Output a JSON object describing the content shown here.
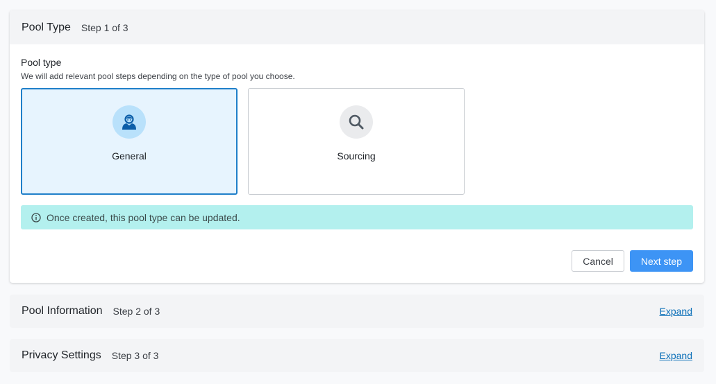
{
  "step1": {
    "title": "Pool Type",
    "count": "Step 1 of 3",
    "field_label": "Pool type",
    "field_help": "We will add relevant pool steps depending on the type of pool you choose.",
    "options": [
      {
        "label": "General",
        "icon": "person-icon",
        "selected": true
      },
      {
        "label": "Sourcing",
        "icon": "search-icon",
        "selected": false
      }
    ],
    "notice": "Once created, this pool type can be updated.",
    "cancel_label": "Cancel",
    "next_label": "Next step"
  },
  "step2": {
    "title": "Pool Information",
    "count": "Step 2 of 3",
    "expand_label": "Expand"
  },
  "step3": {
    "title": "Privacy Settings",
    "count": "Step 3 of 3",
    "expand_label": "Expand"
  },
  "colors": {
    "primary": "#3d94f5",
    "selected_border": "#1f7fc9",
    "selected_bg": "#e7f4fe",
    "notice_bg": "#b3f0ee"
  }
}
